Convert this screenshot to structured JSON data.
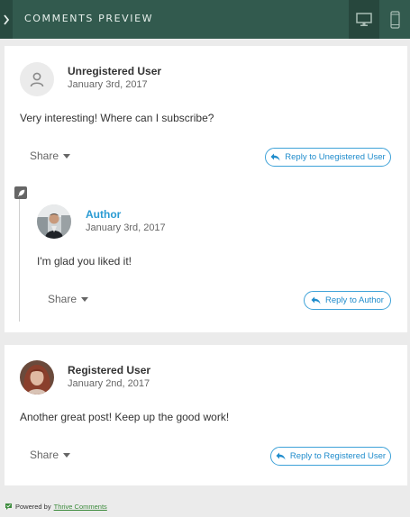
{
  "header": {
    "title": "COMMENTS PREVIEW",
    "icons": [
      "chevron-right-icon",
      "desktop-icon",
      "mobile-icon"
    ]
  },
  "comments": [
    {
      "author": "Unregistered User",
      "date": "January 3rd, 2017",
      "text": "Very interesting! Where can I subscribe?",
      "share_label": "Share",
      "reply_label": "Reply to Unegistered User",
      "avatar": "anonymous-user-icon"
    },
    {
      "author": "Author",
      "date": "January 3rd, 2017",
      "text": "I'm glad you liked it!",
      "share_label": "Share",
      "reply_label": "Reply to Author",
      "avatar": "author-photo",
      "badge_icon": "feather-icon"
    },
    {
      "author": "Registered User",
      "date": "January 2nd, 2017",
      "text": "Another great post! Keep up the good work!",
      "share_label": "Share",
      "reply_label": "Reply to Registered User",
      "avatar": "registered-user-photo"
    }
  ],
  "footer": {
    "powered_by": "Powered by",
    "link": "Thrive Comments"
  },
  "colors": {
    "header_bg": "#325a4e",
    "accent_blue": "#2a9bd3",
    "link_green": "#3c8b3c"
  }
}
